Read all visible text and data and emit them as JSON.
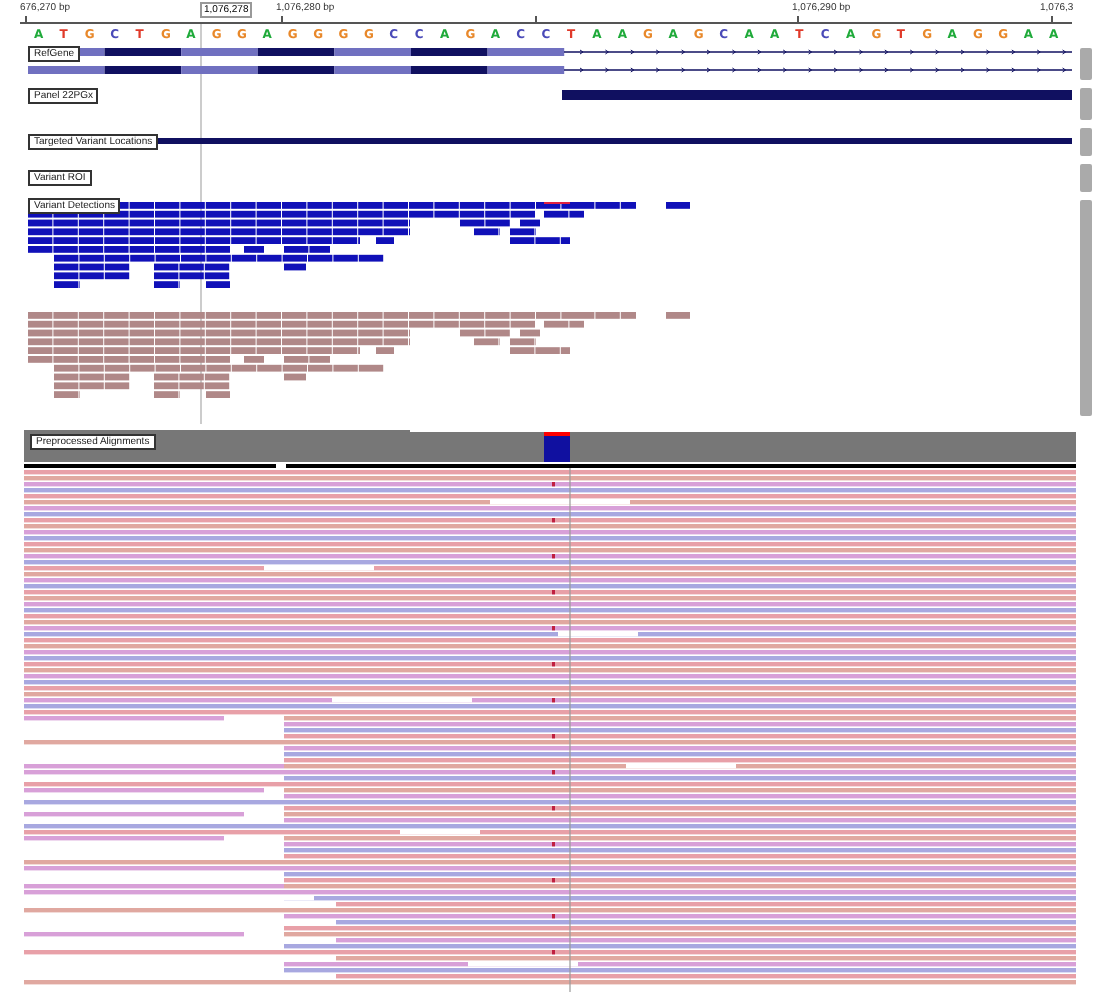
{
  "ruler": {
    "ticks": [
      "676,270 bp",
      "1,076,280 bp",
      "1,076,290 bp",
      "1,076,3"
    ],
    "cursor": "1,076,278"
  },
  "sequence": [
    {
      "base": "A",
      "color": "#1faa3a"
    },
    {
      "base": "T",
      "color": "#e03a2a"
    },
    {
      "base": "G",
      "color": "#e8882a"
    },
    {
      "base": "C",
      "color": "#4a4ab8"
    },
    {
      "base": "T",
      "color": "#e03a2a"
    },
    {
      "base": "G",
      "color": "#e8882a"
    },
    {
      "base": "A",
      "color": "#1faa3a"
    },
    {
      "base": "G",
      "color": "#e8882a"
    },
    {
      "base": "G",
      "color": "#e8882a"
    },
    {
      "base": "A",
      "color": "#1faa3a"
    },
    {
      "base": "G",
      "color": "#e8882a"
    },
    {
      "base": "G",
      "color": "#e8882a"
    },
    {
      "base": "G",
      "color": "#e8882a"
    },
    {
      "base": "G",
      "color": "#e8882a"
    },
    {
      "base": "C",
      "color": "#4a4ab8"
    },
    {
      "base": "C",
      "color": "#4a4ab8"
    },
    {
      "base": "A",
      "color": "#1faa3a"
    },
    {
      "base": "G",
      "color": "#e8882a"
    },
    {
      "base": "A",
      "color": "#1faa3a"
    },
    {
      "base": "C",
      "color": "#4a4ab8"
    },
    {
      "base": "C",
      "color": "#4a4ab8"
    },
    {
      "base": "T",
      "color": "#e03a2a"
    },
    {
      "base": "A",
      "color": "#1faa3a"
    },
    {
      "base": "A",
      "color": "#1faa3a"
    },
    {
      "base": "G",
      "color": "#e8882a"
    },
    {
      "base": "A",
      "color": "#1faa3a"
    },
    {
      "base": "G",
      "color": "#e8882a"
    },
    {
      "base": "C",
      "color": "#4a4ab8"
    },
    {
      "base": "A",
      "color": "#1faa3a"
    },
    {
      "base": "A",
      "color": "#1faa3a"
    },
    {
      "base": "T",
      "color": "#e03a2a"
    },
    {
      "base": "C",
      "color": "#4a4ab8"
    },
    {
      "base": "A",
      "color": "#1faa3a"
    },
    {
      "base": "G",
      "color": "#e8882a"
    },
    {
      "base": "T",
      "color": "#e03a2a"
    },
    {
      "base": "G",
      "color": "#e8882a"
    },
    {
      "base": "A",
      "color": "#1faa3a"
    },
    {
      "base": "G",
      "color": "#e8882a"
    },
    {
      "base": "G",
      "color": "#e8882a"
    },
    {
      "base": "A",
      "color": "#1faa3a"
    },
    {
      "base": "A",
      "color": "#1faa3a"
    }
  ],
  "tracks": [
    {
      "name": "RefGene",
      "kind": "gene"
    },
    {
      "name": "Panel 22PGx",
      "kind": "panel"
    },
    {
      "name": "Targeted Variant Locations",
      "kind": "targets"
    },
    {
      "name": "Variant ROI",
      "kind": "roi"
    },
    {
      "name": "Variant Detections",
      "kind": "detections"
    },
    {
      "name": "Preprocessed Alignments",
      "kind": "alignments"
    }
  ]
}
